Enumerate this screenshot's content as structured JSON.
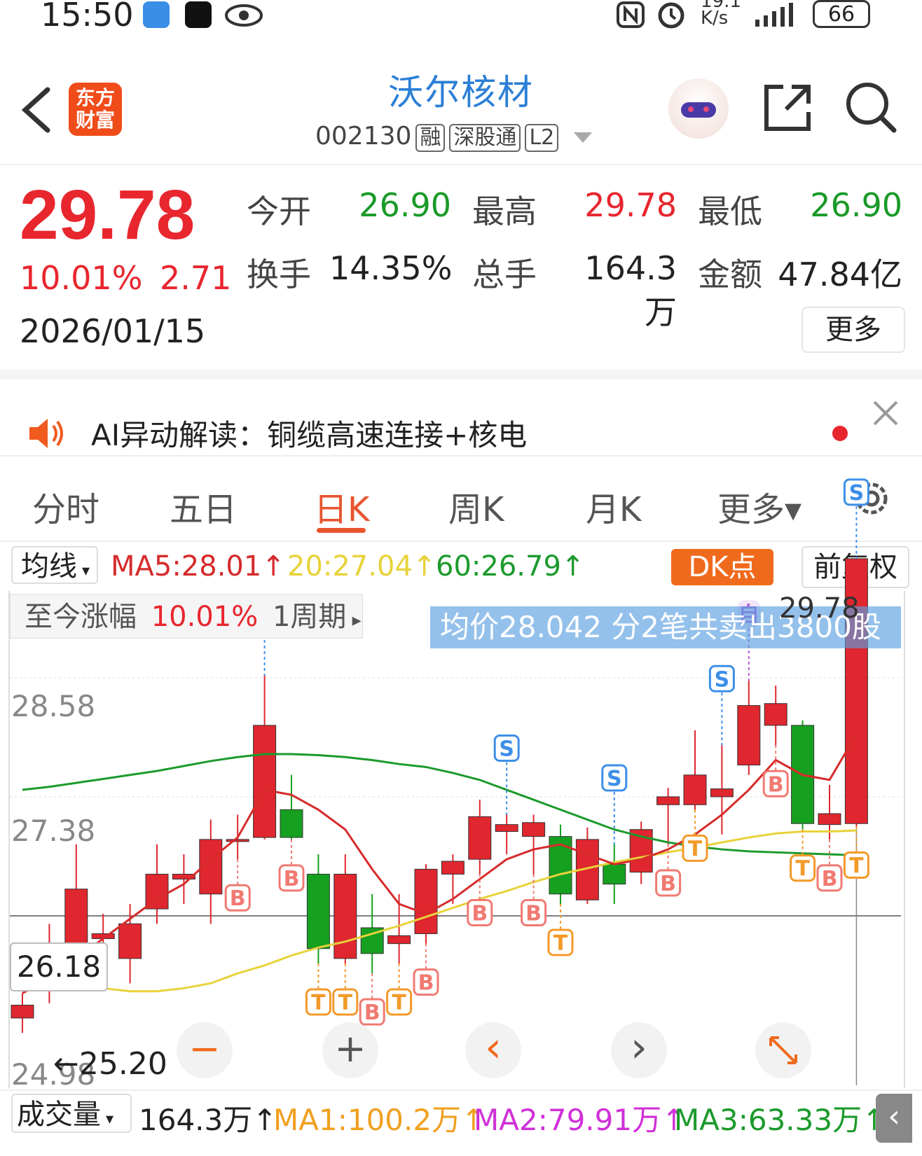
{
  "status_bar": {
    "time": "15:50",
    "net_speed_top": "19.1",
    "net_speed_unit": "K/s",
    "battery": "66"
  },
  "header": {
    "back_icon": "chevron-left-icon",
    "logo_line1": "东方",
    "logo_line2": "财富",
    "stock_name": "沃尔核材",
    "stock_code": "002130",
    "tags": [
      "融",
      "深股通",
      "L2"
    ]
  },
  "quote": {
    "price": "29.78",
    "change_pct": "10.01%",
    "change_amt": "2.71",
    "date": "2026/01/15",
    "open_label": "今开",
    "open": "26.90",
    "high_label": "最高",
    "high": "29.78",
    "low_label": "最低",
    "low": "26.90",
    "turnover_label": "换手",
    "turnover": "14.35%",
    "volume_label": "总手",
    "volume": "164.3万",
    "amount_label": "金额",
    "amount": "47.84亿",
    "more_label": "更多"
  },
  "ai_bar": {
    "text": "AI异动解读：铜缆高速连接+核电"
  },
  "tabs": [
    {
      "label": "分时"
    },
    {
      "label": "五日"
    },
    {
      "label": "日K"
    },
    {
      "label": "周K"
    },
    {
      "label": "月K"
    },
    {
      "label": "更多▾"
    }
  ],
  "ma_bar": {
    "selector": "均线",
    "ma5": "MA5:28.01↑",
    "ma20": "20:27.04↑",
    "ma60": "60:26.79↑",
    "dk_label": "DK点",
    "adjust_label": "前复权"
  },
  "chart_overlay": {
    "since_label": "至今涨幅",
    "since_value": "10.01%",
    "period": "1周期",
    "tooltip": "均价28.042 分2笔共卖出3800股",
    "high_marker": "29.78",
    "crosshair_price": "26.18",
    "low_marker": "25.20",
    "zoom_out": "−",
    "zoom_in": "+",
    "prev": "‹",
    "next": "›"
  },
  "colors": {
    "up": "#e0262e",
    "down": "#16a020",
    "ma5": "#d62b2b",
    "ma20": "#e8d23a",
    "ma60": "#1c9a2c",
    "accent": "#e8542e"
  },
  "chart_data": {
    "type": "candlestick",
    "y_ticks": [
      "28.58",
      "27.38",
      "24.98"
    ],
    "candles": [
      {
        "open": 25.15,
        "close": 25.28,
        "high": 25.4,
        "low": 25.0
      },
      {
        "open": 25.6,
        "close": 25.85,
        "high": 26.1,
        "low": 25.3
      },
      {
        "open": 25.55,
        "close": 26.45,
        "high": 26.9,
        "low": 25.45
      },
      {
        "open": 25.95,
        "close": 26.0,
        "high": 26.2,
        "low": 25.75
      },
      {
        "open": 25.75,
        "close": 26.1,
        "high": 26.3,
        "low": 25.5
      },
      {
        "open": 26.25,
        "close": 26.6,
        "high": 26.9,
        "low": 26.1
      },
      {
        "open": 26.55,
        "close": 26.6,
        "high": 26.8,
        "low": 26.3
      },
      {
        "open": 26.4,
        "close": 26.95,
        "high": 27.15,
        "low": 26.1
      },
      {
        "open": 26.95,
        "close": 26.95,
        "high": 27.2,
        "low": 26.75
      },
      {
        "open": 26.97,
        "close": 28.1,
        "high": 28.6,
        "low": 26.95
      },
      {
        "open": 27.25,
        "close": 26.97,
        "high": 27.6,
        "low": 26.95
      },
      {
        "open": 26.6,
        "close": 25.85,
        "high": 26.8,
        "low": 25.7
      },
      {
        "open": 25.75,
        "close": 26.6,
        "high": 26.8,
        "low": 25.7
      },
      {
        "open": 26.06,
        "close": 25.8,
        "high": 26.4,
        "low": 25.6
      },
      {
        "open": 25.9,
        "close": 25.98,
        "high": 26.4,
        "low": 25.7
      },
      {
        "open": 26.0,
        "close": 26.65,
        "high": 26.7,
        "low": 25.9
      },
      {
        "open": 26.6,
        "close": 26.73,
        "high": 26.8,
        "low": 26.3
      },
      {
        "open": 26.75,
        "close": 27.18,
        "high": 27.35,
        "low": 26.6
      },
      {
        "open": 27.03,
        "close": 27.1,
        "high": 27.2,
        "low": 26.8
      },
      {
        "open": 26.98,
        "close": 27.12,
        "high": 27.2,
        "low": 26.6
      },
      {
        "open": 26.98,
        "close": 26.4,
        "high": 27.1,
        "low": 26.3
      },
      {
        "open": 26.34,
        "close": 26.95,
        "high": 27.07,
        "low": 26.3
      },
      {
        "open": 26.7,
        "close": 26.5,
        "high": 26.9,
        "low": 26.3
      },
      {
        "open": 26.62,
        "close": 27.05,
        "high": 27.13,
        "low": 26.5
      },
      {
        "open": 27.3,
        "close": 27.38,
        "high": 27.47,
        "low": 26.9
      },
      {
        "open": 27.3,
        "close": 27.6,
        "high": 28.05,
        "low": 27.25
      },
      {
        "open": 27.38,
        "close": 27.46,
        "high": 27.9,
        "low": 27.0
      },
      {
        "open": 27.7,
        "close": 28.3,
        "high": 28.55,
        "low": 27.6
      },
      {
        "open": 28.1,
        "close": 28.32,
        "high": 28.5,
        "low": 27.9
      },
      {
        "open": 28.1,
        "close": 27.11,
        "high": 28.15,
        "low": 27.05
      },
      {
        "open": 27.1,
        "close": 27.21,
        "high": 27.5,
        "low": 26.95
      },
      {
        "open": 27.11,
        "close": 29.78,
        "high": 29.78,
        "low": 27.08
      }
    ],
    "ma5": [
      25.4,
      25.55,
      25.75,
      25.95,
      26.15,
      26.35,
      26.5,
      26.75,
      26.97,
      27.45,
      27.4,
      27.25,
      27.05,
      26.65,
      26.3,
      26.2,
      26.35,
      26.55,
      26.75,
      26.85,
      26.9,
      26.8,
      26.7,
      26.75,
      26.85,
      27.0,
      27.2,
      27.45,
      27.75,
      27.6,
      27.55,
      28.01
    ],
    "ma20": [
      25.75,
      25.6,
      25.5,
      25.45,
      25.42,
      25.42,
      25.45,
      25.5,
      25.6,
      25.68,
      25.78,
      25.86,
      25.92,
      26.0,
      26.08,
      26.17,
      26.26,
      26.35,
      26.43,
      26.52,
      26.6,
      26.66,
      26.72,
      26.77,
      26.82,
      26.87,
      26.92,
      26.97,
      27.01,
      27.03,
      27.03,
      27.04
    ],
    "ma60": [
      27.45,
      27.48,
      27.52,
      27.56,
      27.6,
      27.64,
      27.69,
      27.74,
      27.78,
      27.81,
      27.81,
      27.8,
      27.78,
      27.75,
      27.71,
      27.68,
      27.62,
      27.55,
      27.45,
      27.35,
      27.25,
      27.15,
      27.05,
      26.98,
      26.92,
      26.88,
      26.85,
      26.83,
      26.82,
      26.81,
      26.8,
      26.79
    ],
    "markers": [
      {
        "index": 9,
        "label": "S"
      },
      {
        "index": 8,
        "label": "B"
      },
      {
        "index": 10,
        "label": "B"
      },
      {
        "index": 11,
        "label": "T"
      },
      {
        "index": 12,
        "label": "T"
      },
      {
        "index": 13,
        "label": "B"
      },
      {
        "index": 14,
        "label": "T"
      },
      {
        "index": 15,
        "label": "B"
      },
      {
        "index": 17,
        "label": "B"
      },
      {
        "index": 18,
        "label": "S"
      },
      {
        "index": 19,
        "label": "B"
      },
      {
        "index": 20,
        "label": "T"
      },
      {
        "index": 22,
        "label": "S"
      },
      {
        "index": 24,
        "label": "B"
      },
      {
        "index": 25,
        "label": "T"
      },
      {
        "index": 26,
        "label": "S"
      },
      {
        "index": 27,
        "label": "自"
      },
      {
        "index": 28,
        "label": "B"
      },
      {
        "index": 29,
        "label": "T"
      },
      {
        "index": 30,
        "label": "B"
      },
      {
        "index": 31,
        "label": "T"
      },
      {
        "index": 31,
        "label": "S"
      }
    ]
  },
  "volume_bar": {
    "selector": "成交量",
    "volume": "164.3万↑",
    "ma1": "MA1:100.2万↑",
    "ma2": "MA2:79.91万↑",
    "ma3": "MA3:63.33万↑"
  }
}
